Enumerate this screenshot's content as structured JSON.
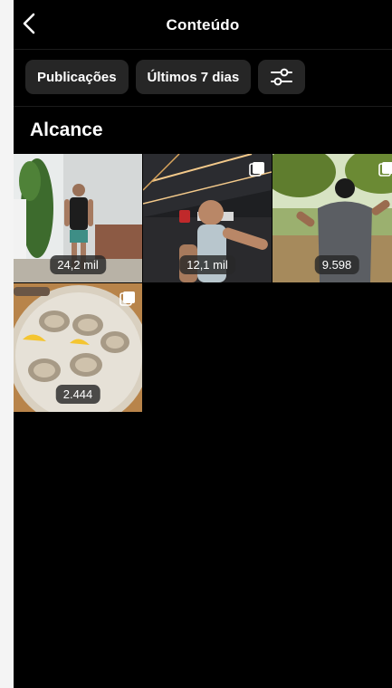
{
  "header": {
    "title": "Conteúdo",
    "back_icon": "chevron-left-icon"
  },
  "filters": {
    "type_label": "Publicações",
    "period_label": "Últimos 7 dias",
    "settings_icon": "sliders-icon"
  },
  "section": {
    "title": "Alcance"
  },
  "posts": [
    {
      "reach": "24,2 mil",
      "multi": false
    },
    {
      "reach": "12,1 mil",
      "multi": true
    },
    {
      "reach": "9.598",
      "multi": true
    },
    {
      "reach": "2.444",
      "multi": true
    }
  ],
  "colors": {
    "background": "#000000",
    "chip": "#262626",
    "text": "#ffffff"
  }
}
